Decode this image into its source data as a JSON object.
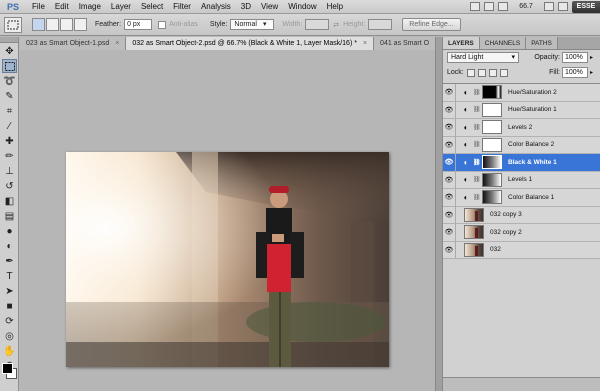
{
  "app": {
    "logo": "PS"
  },
  "menu": [
    "File",
    "Edit",
    "Image",
    "Layer",
    "Select",
    "Filter",
    "Analysis",
    "3D",
    "View",
    "Window",
    "Help"
  ],
  "menubar_right": {
    "zoom": "66.7",
    "workspace": "ESSE"
  },
  "options": {
    "feather_label": "Feather:",
    "feather_value": "0 px",
    "antialias_label": "Anti-alias",
    "style_label": "Style:",
    "style_value": "Normal",
    "width_label": "Width:",
    "height_label": "Height:",
    "refine_label": "Refine Edge..."
  },
  "tabs": [
    {
      "label": "023 as Smart Object-1.psd"
    },
    {
      "label": "032 as Smart Object-2.psd @ 66.7% (Black & White 1, Layer Mask/16) *"
    },
    {
      "label": "041 as Smart O"
    }
  ],
  "tab_close": "×",
  "panel": {
    "tabs": [
      "LAYERS",
      "CHANNELS",
      "PATHS"
    ],
    "blend_mode": "Hard Light",
    "opacity_label": "Opacity:",
    "opacity_value": "100%",
    "lock_label": "Lock:",
    "fill_label": "Fill:",
    "fill_value": "100%"
  },
  "layers": [
    {
      "name": "Hue/Saturation 2",
      "kind": "adjustment",
      "mask": "dark"
    },
    {
      "name": "Hue/Saturation 1",
      "kind": "adjustment",
      "mask": "white"
    },
    {
      "name": "Levels 2",
      "kind": "adjustment",
      "mask": "white"
    },
    {
      "name": "Color Balance 2",
      "kind": "adjustment",
      "mask": "white"
    },
    {
      "name": "Black & White 1",
      "kind": "adjustment",
      "mask": "gradient",
      "selected": true
    },
    {
      "name": "Levels 1",
      "kind": "adjustment",
      "mask": "gradient"
    },
    {
      "name": "Color Balance 1",
      "kind": "adjustment",
      "mask": "gradient"
    },
    {
      "name": "032 copy 3",
      "kind": "photo"
    },
    {
      "name": "032 copy 2",
      "kind": "photo"
    },
    {
      "name": "032",
      "kind": "photo"
    }
  ],
  "colors": {
    "selected_layer": "#3875d7",
    "workspace_bg": "#b6b6b6",
    "logo": "#3d6fb5"
  }
}
